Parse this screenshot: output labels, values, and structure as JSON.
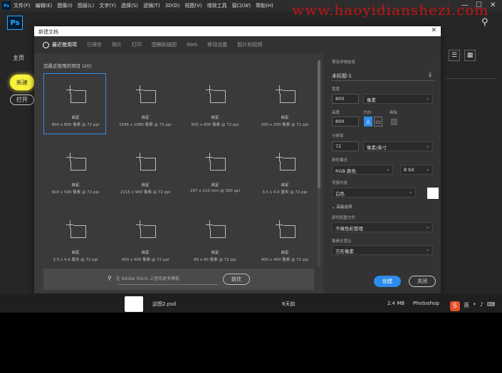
{
  "menubar": {
    "items": [
      "文件(F)",
      "编辑(E)",
      "图像(I)",
      "图层(L)",
      "文字(Y)",
      "选择(S)",
      "滤镜(T)",
      "3D(D)",
      "视图(V)",
      "增效工具",
      "窗口(W)",
      "帮助(H)"
    ]
  },
  "watermark": "www.haoyidianshezi.com",
  "app": {
    "logo": "Ps",
    "home_label": "主页",
    "create_label": "新建",
    "open_label": "打开"
  },
  "dialog": {
    "title": "新建文档",
    "tabs": [
      "最近使用项",
      "已保存",
      "照片",
      "打印",
      "图稿和插图",
      "Web",
      "移动设备",
      "胶片和视频"
    ],
    "recent_header": "您最近使用的项目 (20)",
    "presets": [
      {
        "name": "自定",
        "size": "800 x 800 像素 @ 72 ppi"
      },
      {
        "name": "自定",
        "size": "1936 x 1080 像素 @ 72 ppi"
      },
      {
        "name": "自定",
        "size": "600 x 600 像素 @ 72 ppi"
      },
      {
        "name": "自定",
        "size": "200 x 200 像素 @ 72 ppi"
      },
      {
        "name": "自定",
        "size": "600 x 500 像素 @ 72 ppi"
      },
      {
        "name": "自定",
        "size": "2115 x 900 像素 @ 72 ppi"
      },
      {
        "name": "自定",
        "size": "297 x 210 mm @ 300 ppi"
      },
      {
        "name": "自定",
        "size": "3.5 x 4.9 厘米 @ 72 ppi"
      },
      {
        "name": "自定",
        "size": "3.5 x 4.9 厘米 @ 72 ppi"
      },
      {
        "name": "自定",
        "size": "400 x 400 像素 @ 72 ppi"
      },
      {
        "name": "自定",
        "size": "80 x 80 像素 @ 72 ppi"
      },
      {
        "name": "自定",
        "size": "400 x 400 像素 @ 72 ppi"
      }
    ],
    "stock_placeholder": "在 Adobe Stock 上查找更多模板",
    "stock_go": "前往",
    "details": {
      "section_label": "预设详细信息",
      "doc_name": "未标题-1",
      "width_label": "宽度",
      "width_value": "800",
      "width_unit": "像素",
      "height_label": "高度",
      "height_value": "800",
      "orientation_label": "方向",
      "artboard_label": "画板",
      "resolution_label": "分辨率",
      "resolution_value": "72",
      "resolution_unit": "像素/英寸",
      "color_mode_label": "颜色模式",
      "color_mode_value": "RGB 颜色",
      "bit_depth": "8 bit",
      "bg_label": "背景内容",
      "bg_value": "白色",
      "advanced_label": "高级选项",
      "profile_label": "颜色配置文件",
      "profile_value": "不做色彩管理",
      "aspect_label": "像素长宽比",
      "aspect_value": "方形像素"
    },
    "create_button": "创建",
    "close_button": "关闭"
  },
  "file_row": {
    "name": "这图2.psd",
    "time": "6天前",
    "size": "2.4 MB",
    "type": "Photoshop"
  },
  "taskbar": {
    "ime": "英"
  }
}
